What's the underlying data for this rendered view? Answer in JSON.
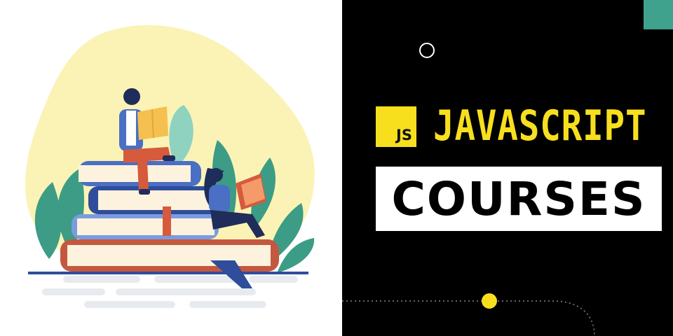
{
  "banner": {
    "badge_text": "JS",
    "title": "JAVASCRIPT",
    "subtitle": "COURSES"
  },
  "colors": {
    "panel": "#000000",
    "yellow": "#f7df1e",
    "accent": "#3fa28c",
    "blob": "#fbf3b5",
    "leaf": "#3c9c86",
    "book_blue": "#4a6fc4",
    "book_red": "#c4583f"
  },
  "icons": {
    "illustration": "people-reading-on-books-illustration",
    "ring": "ring-icon",
    "dot": "yellow-dot-icon"
  }
}
